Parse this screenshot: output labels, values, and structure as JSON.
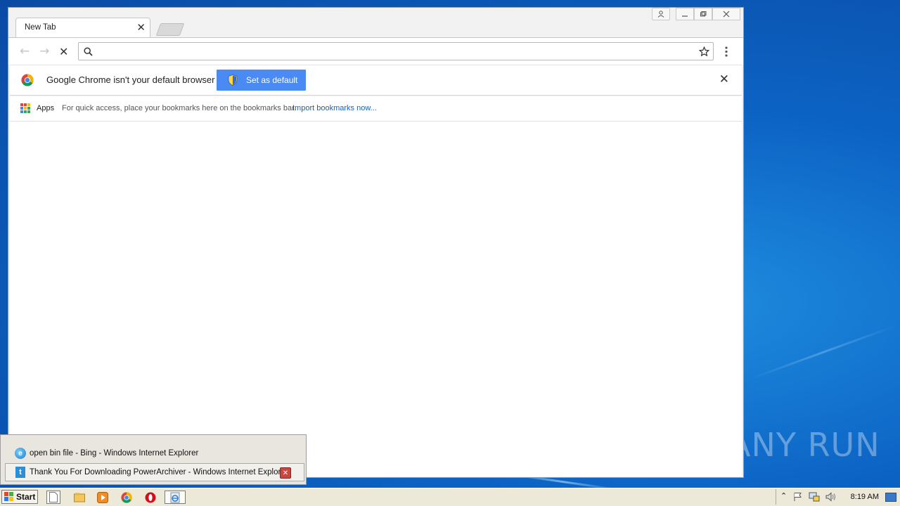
{
  "browser": {
    "tab_title": "New Tab",
    "omnibox_value": "",
    "omnibox_placeholder": ""
  },
  "infobar": {
    "message": "Google Chrome isn't your default browser",
    "button_label": "Set as default"
  },
  "bookmarks_bar": {
    "apps_label": "Apps",
    "hint_text": "For quick access, place your bookmarks here on the bookmarks bar.",
    "import_link": "Import bookmarks now..."
  },
  "taskbar_popup": {
    "items": [
      {
        "label": "open bin file - Bing - Windows Internet Explorer"
      },
      {
        "label": "Thank You For Downloading PowerArchiver - Windows Internet Explorer"
      }
    ]
  },
  "taskbar": {
    "start_label": "Start",
    "clock": "8:19 AM"
  },
  "watermark": "ANY RUN",
  "colors": {
    "accent_button": "#4a8af4",
    "link": "#1a5fb4"
  }
}
